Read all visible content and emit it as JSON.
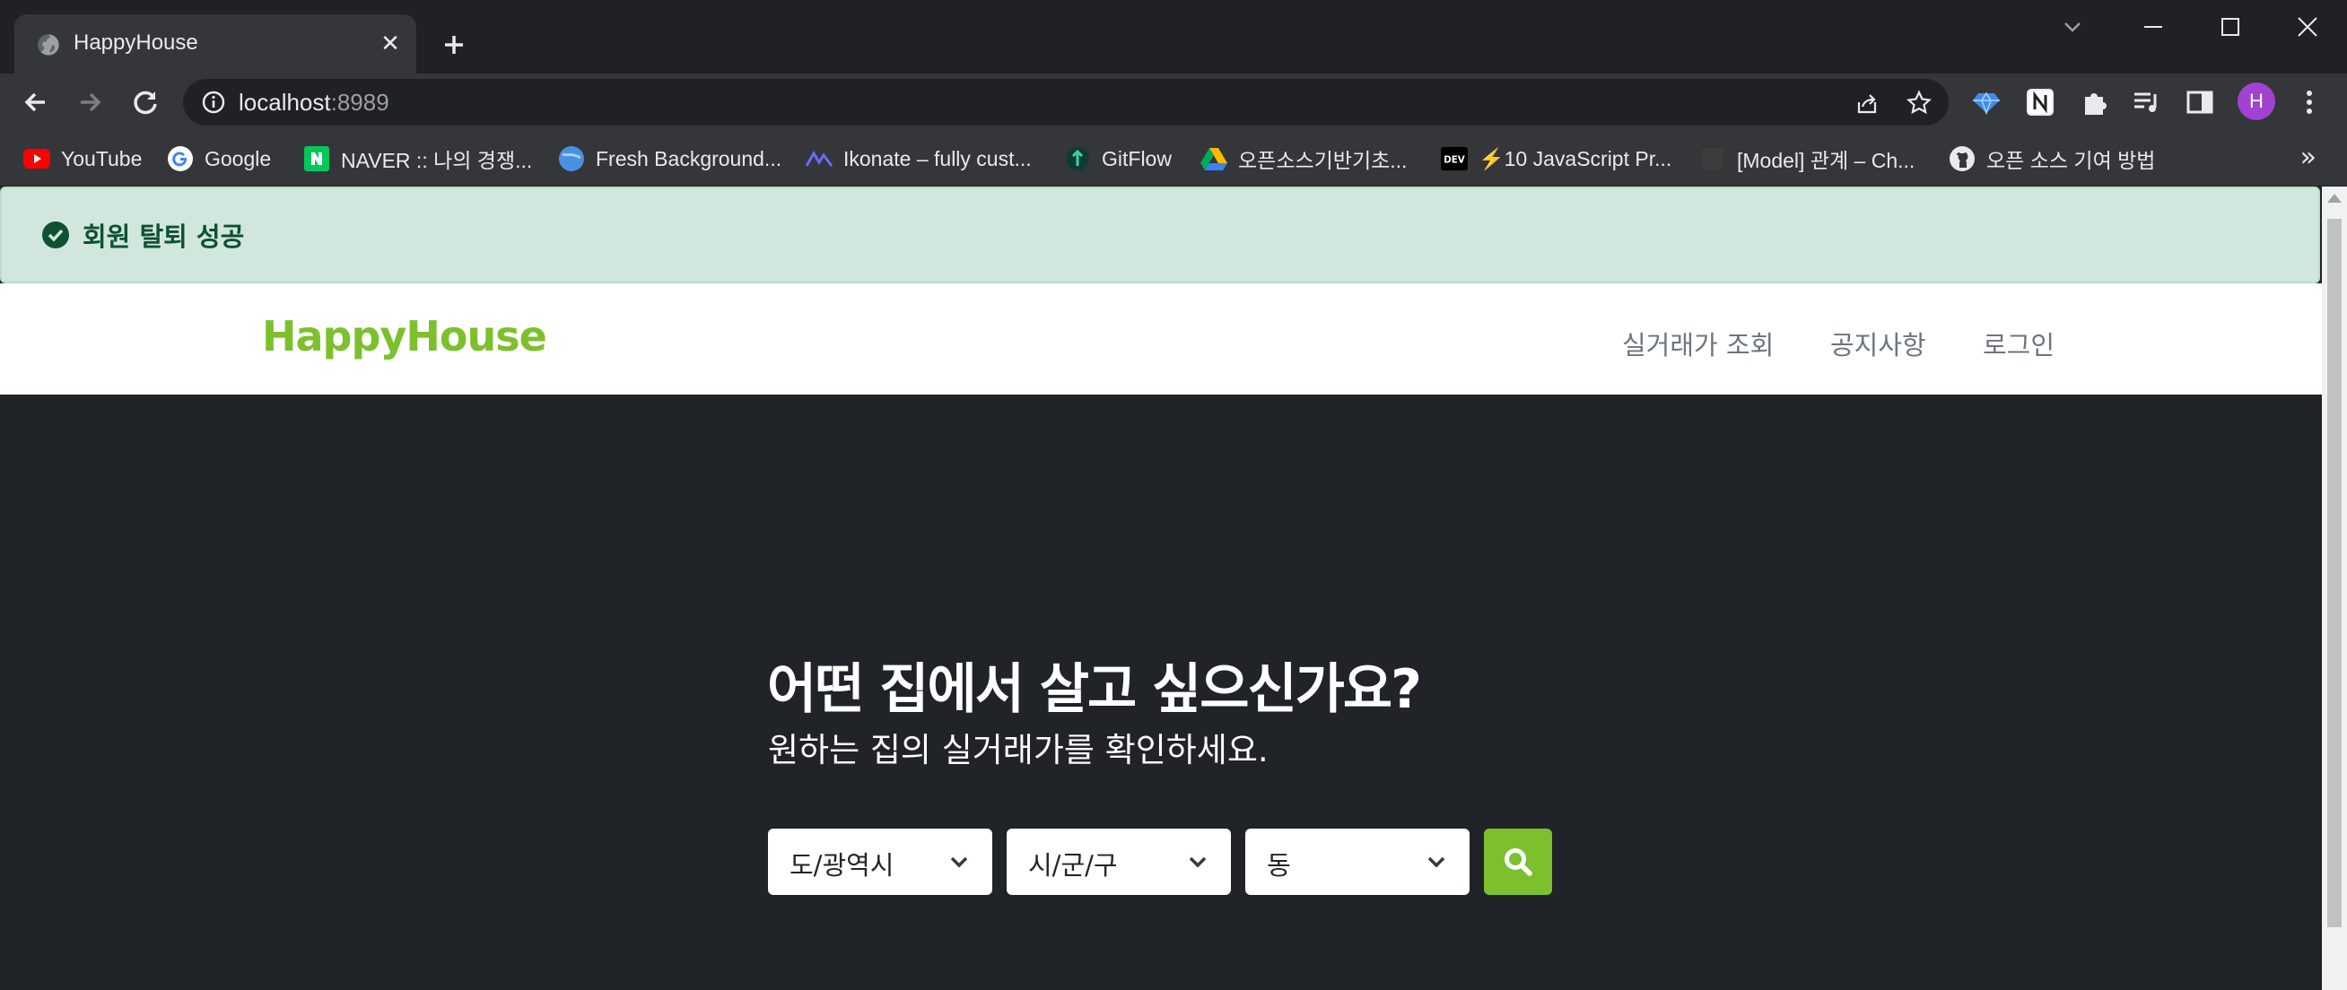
{
  "browser": {
    "tab_title": "HappyHouse",
    "url_host": "localhost",
    "url_port": ":8989",
    "profile_initial": "H",
    "bookmarks": [
      {
        "label": "YouTube",
        "icon": "youtube-icon"
      },
      {
        "label": "Google",
        "icon": "google-icon"
      },
      {
        "label": "NAVER :: 나의 경쟁...",
        "icon": "naver-icon"
      },
      {
        "label": "Fresh Background...",
        "icon": "globe-blue-icon"
      },
      {
        "label": "Ikonate – fully cust...",
        "icon": "ikonate-icon"
      },
      {
        "label": "GitFlow",
        "icon": "gitflow-icon"
      },
      {
        "label": "오픈소스기반기초...",
        "icon": "google-drive-icon"
      },
      {
        "label": "⚡10 JavaScript Pr...",
        "icon": "dev-icon"
      },
      {
        "label": "[Model] 관계 – Ch...",
        "icon": "dark-page-icon"
      },
      {
        "label": "오픈 소스 기여 방법",
        "icon": "github-icon"
      }
    ]
  },
  "alert": {
    "message": "회원 탈퇴 성공",
    "color": "#0f5132"
  },
  "navbar": {
    "brand": "HappyHouse",
    "brand_color": "#7dc02e",
    "links": [
      "실거래가 조회",
      "공지사항",
      "로그인"
    ]
  },
  "hero": {
    "title": "어떤 집에서 살고 싶으신가요?",
    "subtitle": "원하는 집의 실거래가를 확인하세요.",
    "selects": [
      "도/광역시",
      "시/군/구",
      "동"
    ]
  }
}
